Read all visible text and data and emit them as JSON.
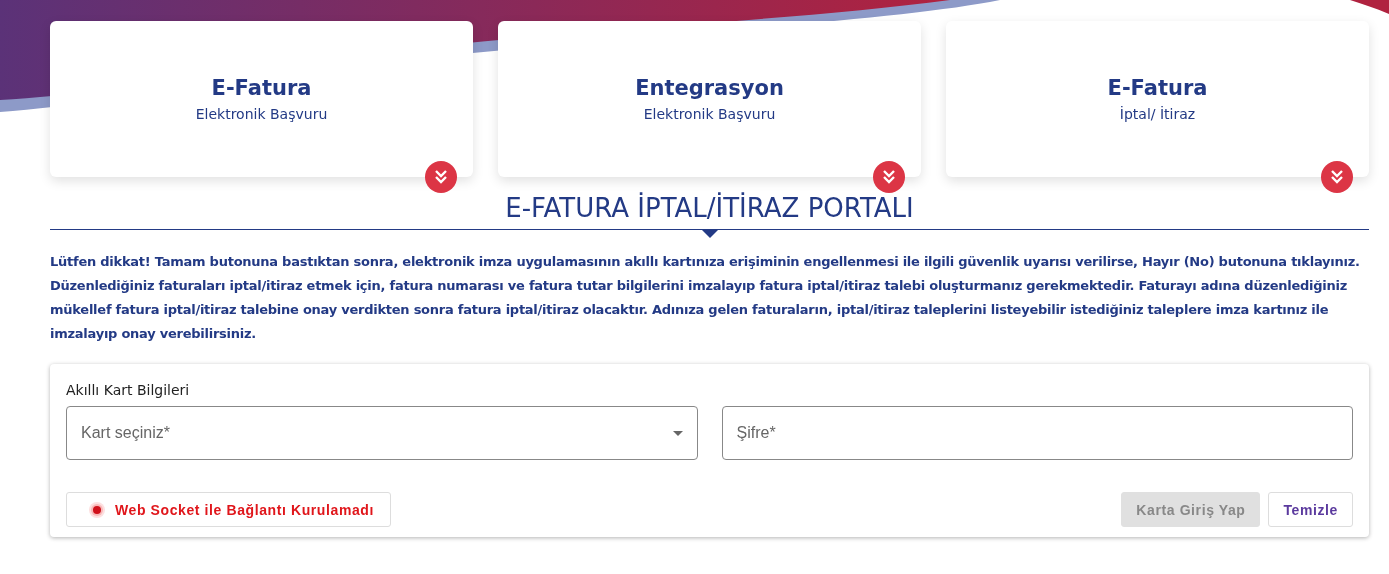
{
  "cards": [
    {
      "title": "E-Fatura",
      "subtitle": "Elektronik Başvuru"
    },
    {
      "title": "Entegrasyon",
      "subtitle": "Elektronik Başvuru"
    },
    {
      "title": "E-Fatura",
      "subtitle": "İptal/ İtiraz"
    }
  ],
  "portal_title": "E-FATURA İPTAL/İTİRAZ PORTALI",
  "notice": "Lütfen dikkat! Tamam butonuna bastıktan sonra, elektronik imza uygulamasının akıllı kartınıza erişiminin engellenmesi ile ilgili güvenlik uyarısı verilirse, Hayır (No) butonuna tıklayınız. Düzenlediğiniz faturaları iptal/itiraz etmek için, fatura numarası ve fatura tutar bilgilerini imzalayıp fatura iptal/itiraz talebi oluşturmanız gerekmektedir. Faturayı adına düzenlediğiniz mükellef fatura iptal/itiraz talebine onay verdikten sonra fatura iptal/itiraz olacaktır. Adınıza gelen faturaların, iptal/itiraz taleplerini listeyebilir istediğiniz taleplere imza kartınız ile imzalayıp onay verebilirsiniz.",
  "form": {
    "title": "Akıllı Kart Bilgileri",
    "card_select": {
      "placeholder": "Kart seçiniz*"
    },
    "password": {
      "placeholder": "Şifre*"
    },
    "socket_status": {
      "label": "Web Socket ile Bağlantı Kurulamadı",
      "connected": false
    },
    "buttons": [
      {
        "label": "Karta Giriş Yap",
        "disabled": true
      },
      {
        "label": "Temizle",
        "disabled": false
      }
    ]
  }
}
